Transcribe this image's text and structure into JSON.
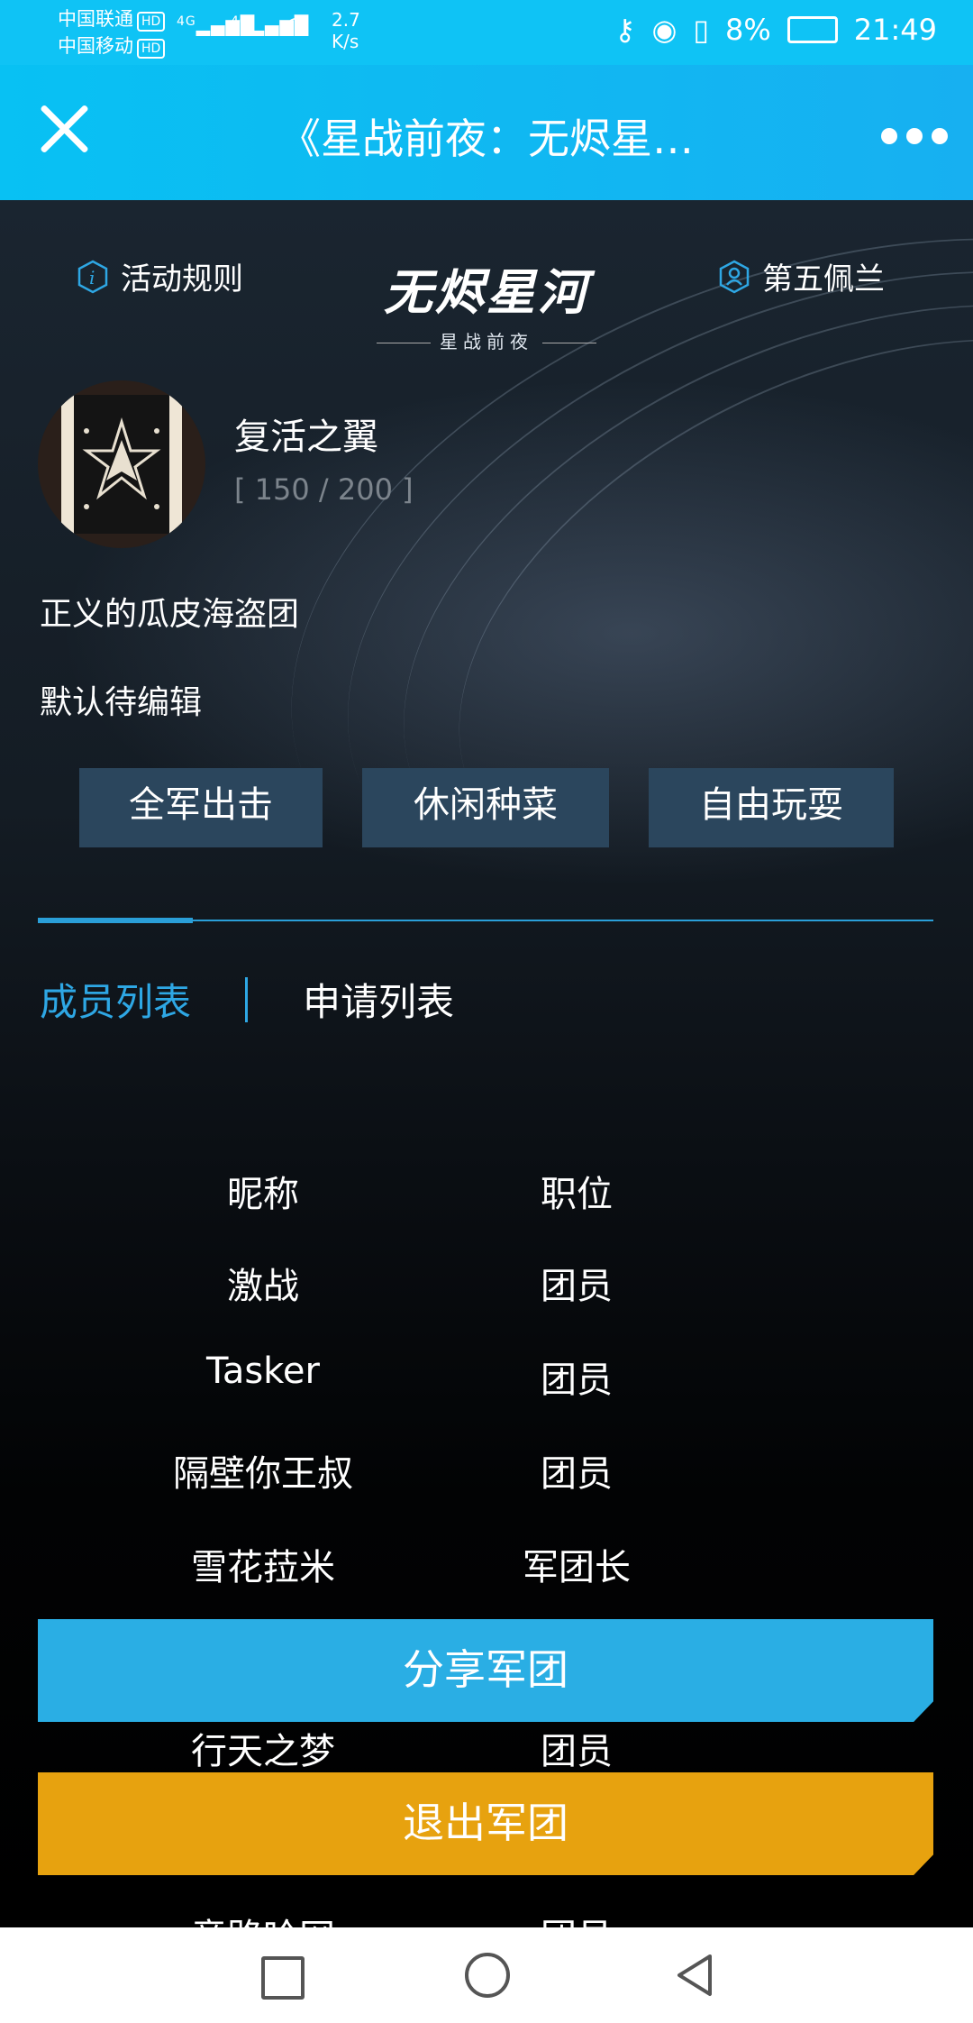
{
  "status_bar": {
    "carrier1": "中国联通",
    "carrier2": "中国移动",
    "hd": "HD",
    "net1": "4G",
    "net2": "4G",
    "speed_value": "2.7",
    "speed_unit": "K/s",
    "battery": "8%",
    "time": "21:49"
  },
  "titlebar": {
    "title": "《星战前夜：无烬星…"
  },
  "header": {
    "rules_label": "活动规则",
    "logo_title": "无烬星河",
    "logo_subtitle": "星战前夜",
    "user_label": "第五佩兰"
  },
  "guild": {
    "name": "复活之翼",
    "count": "[ 150 / 200 ]",
    "slogan": "正义的瓜皮海盗团",
    "description": "默认待编辑",
    "tags": [
      "全军出击",
      "休闲种菜",
      "自由玩耍"
    ]
  },
  "tabs": {
    "members": "成员列表",
    "applications": "申请列表"
  },
  "table": {
    "headers": [
      "昵称",
      "职位"
    ],
    "rows": [
      [
        "激战",
        "团员"
      ],
      [
        "Tasker",
        "团员"
      ],
      [
        "隔壁你王叔",
        "团员"
      ],
      [
        "雪花菈米",
        "军团长"
      ],
      [
        "行天之梦",
        "团员"
      ],
      [
        "竞路哈网",
        "团员"
      ]
    ]
  },
  "buttons": {
    "share": "分享军团",
    "exit": "退出军团"
  },
  "colors": {
    "title_bar": "#0fc3f5",
    "accent_blue": "#2aaee4",
    "tag_bg": "#2b465d",
    "exit_orange": "#e7a20f"
  }
}
